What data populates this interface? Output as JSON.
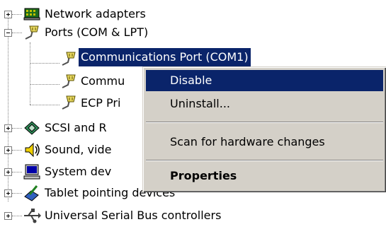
{
  "tree": {
    "items": [
      {
        "label": "Network adapters",
        "icon": "network-adapter-icon"
      },
      {
        "label": "Ports (COM & LPT)",
        "icon": "port-connector-icon"
      },
      {
        "label": "Communications Port (COM1)",
        "icon": "port-connector-icon"
      },
      {
        "label": "Commu",
        "icon": "port-connector-icon"
      },
      {
        "label": "ECP Pri",
        "icon": "port-connector-icon"
      },
      {
        "label": "SCSI and R",
        "icon": "scsi-icon"
      },
      {
        "label": "Sound, vide",
        "icon": "speaker-icon"
      },
      {
        "label": "System dev",
        "icon": "computer-icon"
      },
      {
        "label": "Tablet pointing devices",
        "icon": "tablet-pen-icon"
      },
      {
        "label": "Universal Serial Bus controllers",
        "icon": "usb-icon"
      }
    ]
  },
  "context_menu": {
    "items": [
      {
        "label": "Disable"
      },
      {
        "label": "Uninstall..."
      },
      {
        "label": "Scan for hardware changes"
      },
      {
        "label": "Properties"
      }
    ]
  },
  "colors": {
    "selection": "#0a246a",
    "menu_background": "#d4d0c8"
  }
}
